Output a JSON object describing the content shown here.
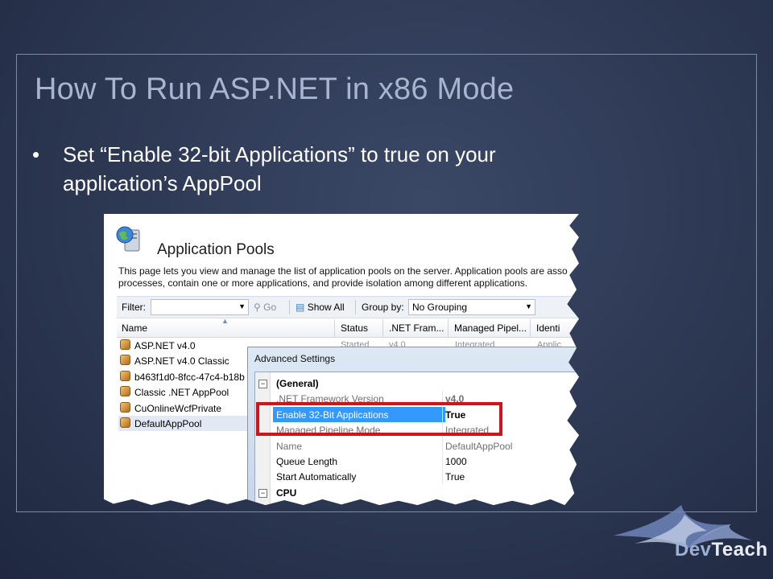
{
  "slide": {
    "title": "How To Run ASP.NET in x86 Mode",
    "bullet_marker": "•",
    "bullet_text": "Set “Enable 32-bit Applications” to true on your application’s AppPool"
  },
  "iis": {
    "title": "Application Pools",
    "description_line1": "This page lets you view and manage the list of application pools on the server. Application pools are asso",
    "description_line2": "processes, contain one or more applications, and provide isolation among different applications.",
    "filter_label": "Filter:",
    "go_label": "Go",
    "show_all_label": "Show All",
    "group_by_label": "Group by:",
    "group_by_value": "No Grouping",
    "columns": [
      "Name",
      "Status",
      ".NET Fram...",
      "Managed Pipel...",
      "Identi"
    ],
    "pools": [
      "ASP.NET v4.0",
      "ASP.NET v4.0 Classic",
      "b463f1d0-8fcc-47c4-b18b",
      "Classic .NET AppPool",
      "CuOnlineWcfPrivate",
      "DefaultAppPool"
    ],
    "row0_status": "Started",
    "row0_framework": "v4.0",
    "row0_pipeline": "Integrated",
    "row0_identity": "Applic"
  },
  "advanced_settings": {
    "title": "Advanced Settings",
    "group_general": "(General)",
    "group_cpu": "CPU",
    "expander_symbol": "⊟",
    "properties": [
      {
        "name": ".NET Framework Version",
        "value": "v4.0"
      },
      {
        "name": "Enable 32-Bit Applications",
        "value": "True"
      },
      {
        "name": "Managed Pipeline Mode",
        "value": "Integrated"
      },
      {
        "name": "Name",
        "value": "DefaultAppPool"
      },
      {
        "name": "Queue Length",
        "value": "1000"
      },
      {
        "name": "Start Automatically",
        "value": "True"
      }
    ]
  },
  "brand": {
    "part1": "Dev",
    "part2": "Teach"
  },
  "colors": {
    "background": "#2c3752",
    "title": "#a9b5cf",
    "highlight": "#d0141a",
    "selection": "#3399ff"
  }
}
